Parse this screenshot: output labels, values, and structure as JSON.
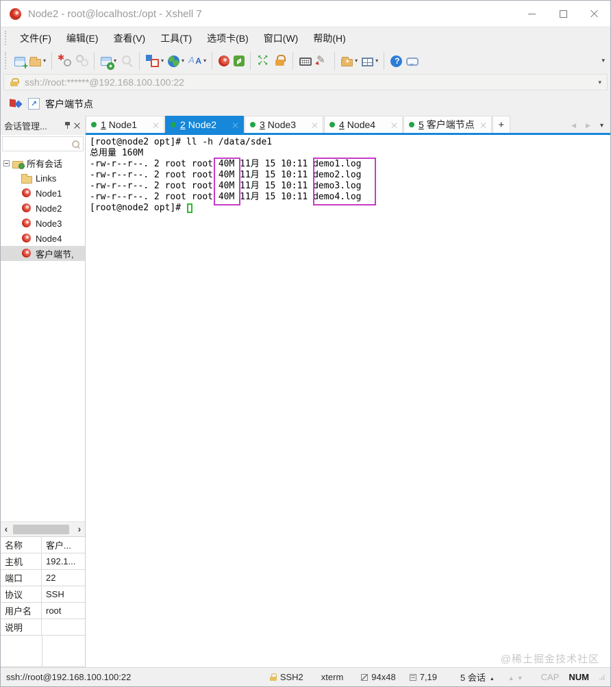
{
  "window": {
    "title": "Node2 - root@localhost:/opt - Xshell 7"
  },
  "menu": {
    "items": [
      "文件(F)",
      "编辑(E)",
      "查看(V)",
      "工具(T)",
      "选项卡(B)",
      "窗口(W)",
      "帮助(H)"
    ]
  },
  "toolbar": {
    "buttons": [
      {
        "id": "new-session",
        "icon": "new-session-icon"
      },
      {
        "id": "open-folder",
        "icon": "open-session-icon",
        "dropdown": true
      },
      {
        "id": "disconnect",
        "icon": "disconnect-icon",
        "sep": true
      },
      {
        "id": "reconnect",
        "icon": "reconnect-icon",
        "disabled": true
      },
      {
        "id": "session-properties",
        "icon": "session-properties-icon",
        "dropdown": true,
        "sep": true
      },
      {
        "id": "find",
        "icon": "find-icon",
        "disabled": true
      },
      {
        "id": "tile-layout",
        "icon": "tile-layout-icon",
        "dropdown": true,
        "sep": true
      },
      {
        "id": "encoding-globe",
        "icon": "encoding-globe-icon",
        "dropdown": true
      },
      {
        "id": "font",
        "icon": "font-icon",
        "dropdown": true
      },
      {
        "id": "xagent",
        "icon": "xagent-shell-icon",
        "sep": true
      },
      {
        "id": "xftp",
        "icon": "xftp-transfer-icon"
      },
      {
        "id": "fullscreen",
        "icon": "fullscreen-icon",
        "sep": true
      },
      {
        "id": "lock",
        "icon": "lock-screen-icon"
      },
      {
        "id": "keyboard",
        "icon": "virtual-keyboard-icon",
        "sep": true
      },
      {
        "id": "highlighter",
        "icon": "highlighter-icon"
      },
      {
        "id": "new-file-transfer",
        "icon": "new-file-transfer-icon",
        "dropdown": true,
        "sep": true
      },
      {
        "id": "split-window",
        "icon": "split-window-icon",
        "dropdown": true
      },
      {
        "id": "help",
        "icon": "help-icon",
        "sep": true
      },
      {
        "id": "feedback",
        "icon": "feedback-icon"
      }
    ]
  },
  "address": {
    "url": "ssh://root:******@192.168.100.100:22"
  },
  "bookmark": {
    "label": "客户端节点"
  },
  "session_panel": {
    "title": "会话管理...",
    "tree": [
      {
        "label": "所有会话",
        "icon": "folder-gear",
        "level": 0,
        "expander": true
      },
      {
        "label": "Links",
        "icon": "folder",
        "level": 1
      },
      {
        "label": "Node1",
        "icon": "shell",
        "level": 1
      },
      {
        "label": "Node2",
        "icon": "shell",
        "level": 1
      },
      {
        "label": "Node3",
        "icon": "shell",
        "level": 1
      },
      {
        "label": "Node4",
        "icon": "shell",
        "level": 1
      },
      {
        "label": "客户端节,",
        "icon": "shell",
        "level": 1,
        "selected": true
      }
    ]
  },
  "tabs": {
    "items": [
      {
        "num": "1",
        "label": "Node1"
      },
      {
        "num": "2",
        "label": "Node2",
        "active": true
      },
      {
        "num": "3",
        "label": "Node3"
      },
      {
        "num": "4",
        "label": "Node4"
      },
      {
        "num": "5",
        "label": "客户端节点"
      }
    ]
  },
  "terminal": {
    "lines": [
      "[root@node2 opt]# ll -h /data/sde1",
      "总用量 160M",
      "-rw-r--r--. 2 root root 40M 11月 15 10:11 demo1.log",
      "-rw-r--r--. 2 root root 40M 11月 15 10:11 demo2.log",
      "-rw-r--r--. 2 root root 40M 11月 15 10:11 demo3.log",
      "-rw-r--r--. 2 root root 40M 11月 15 10:11 demo4.log"
    ],
    "prompt": "[root@node2 opt]# ",
    "highlight_color": "#c73bc7",
    "cursor_color": "#2db82d"
  },
  "properties": {
    "rows": [
      {
        "key": "名称",
        "value": "客户..."
      },
      {
        "key": "主机",
        "value": "192.1..."
      },
      {
        "key": "端口",
        "value": "22"
      },
      {
        "key": "协议",
        "value": "SSH"
      },
      {
        "key": "用户名",
        "value": "root"
      },
      {
        "key": "说明",
        "value": ""
      }
    ]
  },
  "statusbar": {
    "url": "ssh://root@192.168.100.100:22",
    "protocol": "SSH2",
    "terminal_type": "xterm",
    "size": "94x48",
    "position": "7,19",
    "sessions": "5 会话",
    "cap": "CAP",
    "num": "NUM"
  },
  "watermark": "@稀土掘金技术社区",
  "colors": {
    "accent_blue": "#1687d9",
    "highlight_magenta": "#c73bc7",
    "connected_green": "#21a546",
    "cursor_green": "#2db82d",
    "toolbar_bg": "#f0f0f0"
  },
  "icons": {
    "minimize": "—",
    "maximize": "□",
    "close": "×",
    "pin": "push-pin",
    "dropdown": "▾",
    "tab_prev": "◀",
    "tab_next": "▶",
    "new_tab": "+",
    "tree_collapse": "−",
    "search": "magnifier",
    "address_lock": "padlock",
    "scroll_left": "‹",
    "scroll_right": "›",
    "session_up": "▲",
    "session_down": "▼",
    "resize_grip": "dots"
  }
}
